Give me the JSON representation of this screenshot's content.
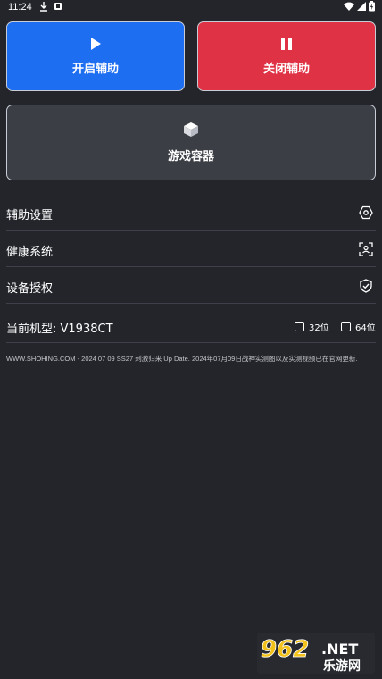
{
  "status": {
    "time": "11:24"
  },
  "buttons": {
    "start": "开启辅助",
    "stop": "关闭辅助",
    "game_container": "游戏容器"
  },
  "menu": [
    {
      "label": "辅助设置",
      "icon": "hexagon-settings-icon"
    },
    {
      "label": "健康系统",
      "icon": "face-scan-icon"
    },
    {
      "label": "设备授权",
      "icon": "shield-check-icon"
    }
  ],
  "model": {
    "label": "当前机型:  V1938CT",
    "options": [
      "32位",
      "64位"
    ]
  },
  "notice": "WWW.SHOHING.COM - 2024 07 09 SS27 刺激归来 Up Date. 2024年07月09日战神实测图以及实测视频已在官网更新.",
  "watermark": {
    "brand": "962",
    "suffix": ".NET",
    "site": "乐游网"
  },
  "colors": {
    "background": "#23252b",
    "start": "#1e6ef2",
    "stop": "#df3345",
    "container": "#3b3e45"
  }
}
